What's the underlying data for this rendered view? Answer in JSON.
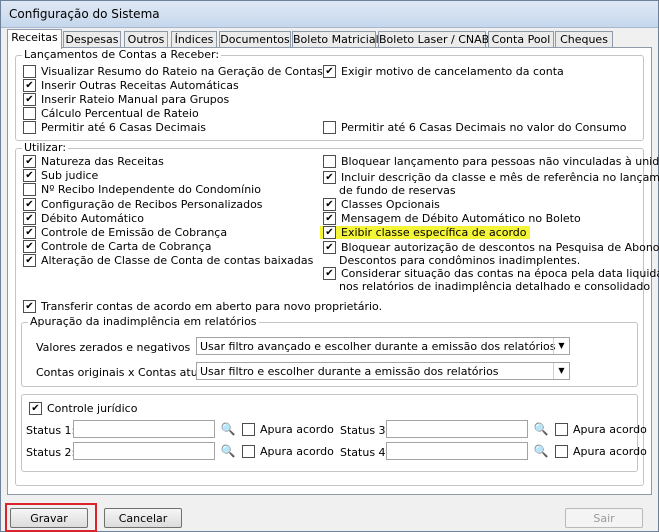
{
  "window": {
    "title": "Configuração do Sistema"
  },
  "tabs": [
    {
      "label": "Receitas"
    },
    {
      "label": "Despesas"
    },
    {
      "label": "Outros"
    },
    {
      "label": "Índices"
    },
    {
      "label": "Documentos"
    },
    {
      "label": "Boleto Matricial"
    },
    {
      "label": "Boleto Laser / CNAB"
    },
    {
      "label": "Conta Pool"
    },
    {
      "label": "Cheques"
    }
  ],
  "lancamentos": {
    "title": "Lançamentos de Contas a Receber:",
    "left": [
      {
        "label": "Visualizar Resumo do Rateio na Geração de Contas",
        "checked": false
      },
      {
        "label": "Inserir Outras Receitas Automáticas",
        "checked": true
      },
      {
        "label": "Inserir Rateio Manual para Grupos",
        "checked": true
      },
      {
        "label": "Cálculo Percentual de Rateio",
        "checked": false
      },
      {
        "label": "Permitir até 6 Casas Decimais",
        "checked": false
      }
    ],
    "right": [
      {
        "label": "Exigir motivo de cancelamento da conta",
        "checked": true
      },
      {
        "label": "Permitir até 6 Casas Decimais no valor do Consumo",
        "checked": false
      }
    ]
  },
  "utilizar": {
    "title": "Utilizar:",
    "left": [
      {
        "label": "Natureza das Receitas",
        "checked": true
      },
      {
        "label": "Sub judice",
        "checked": true
      },
      {
        "label": "Nº Recibo Independente do Condomínio",
        "checked": false
      },
      {
        "label": "Configuração de Recibos Personalizados",
        "checked": true
      },
      {
        "label": "Débito Automático",
        "checked": true
      },
      {
        "label": "Controle de Emissão de Cobrança",
        "checked": true
      },
      {
        "label": "Controle de Carta de Cobrança",
        "checked": true
      },
      {
        "label": "Alteração de Classe de Conta de contas baixadas",
        "checked": true
      }
    ],
    "right": [
      {
        "label": "Bloquear lançamento para pessoas não vinculadas à unidade",
        "checked": false
      },
      {
        "label": "Incluir descrição da classe e mês de referência no lançamento",
        "label2": "de fundo de reservas",
        "checked": true
      },
      {
        "label": "Classes Opcionais",
        "checked": true
      },
      {
        "label": "Mensagem de Débito Automático no Boleto",
        "checked": true
      },
      {
        "label": "Exibir classe específica de acordo",
        "checked": true
      },
      {
        "label": "Bloquear autorização de descontos na Pesquisa de Abonos e",
        "label2": "Descontos para condôminos inadimplentes.",
        "checked": true
      },
      {
        "label": "Considerar situação das contas na época pela data liquidação",
        "label2": "nos relatórios de inadimplência detalhado e consolidado",
        "checked": true
      }
    ],
    "transferir": {
      "label": "Transferir contas de acordo em aberto para novo proprietário.",
      "checked": true
    }
  },
  "apuracao": {
    "title": "Apuração da inadimplência em relatórios",
    "valores_label": "Valores zerados e negativos",
    "valores_value": "Usar filtro avançado e escolher durante a emissão dos relatórios",
    "contas_label": "Contas originais x Contas atuais",
    "contas_value": "Usar filtro e escolher durante a emissão dos relatórios"
  },
  "juridico": {
    "label": "Controle jurídico",
    "checked": true,
    "apura_label": "Apura acordo",
    "status": [
      {
        "label": "Status 1:",
        "value": ""
      },
      {
        "label": "Status 2:",
        "value": ""
      },
      {
        "label": "Status 3:",
        "value": ""
      },
      {
        "label": "Status 4:",
        "value": ""
      }
    ]
  },
  "footer": {
    "gravar": "Gravar",
    "cancelar": "Cancelar",
    "sair": "Sair"
  },
  "colors": {
    "highlight": "#f5f538",
    "annotation_box": "#d9242b"
  },
  "icons": {
    "search": "binoculars-icon",
    "dropdown": "chevron-down-icon"
  }
}
